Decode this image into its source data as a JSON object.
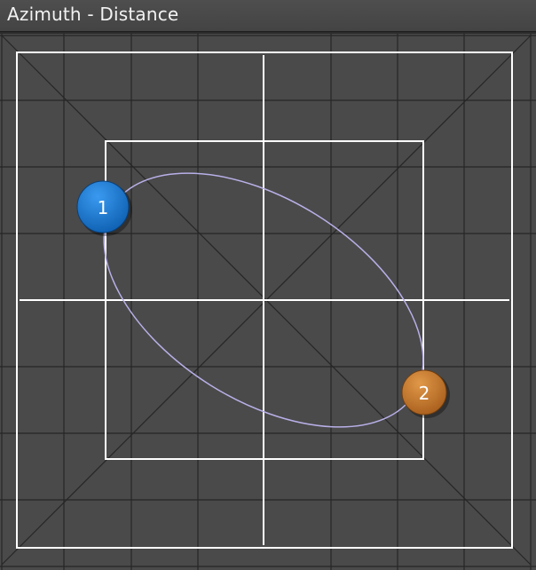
{
  "window": {
    "title": "Azimuth - Distance"
  },
  "points": [
    {
      "label": "1",
      "color": "#1576d1",
      "highlight": "#3a9af0"
    },
    {
      "label": "2",
      "color": "#c67628",
      "highlight": "#e09848"
    }
  ],
  "colors": {
    "background": "#4a4a4a",
    "grid": "#262626",
    "guide": "#ffffff",
    "path": "#b8b0e8"
  }
}
